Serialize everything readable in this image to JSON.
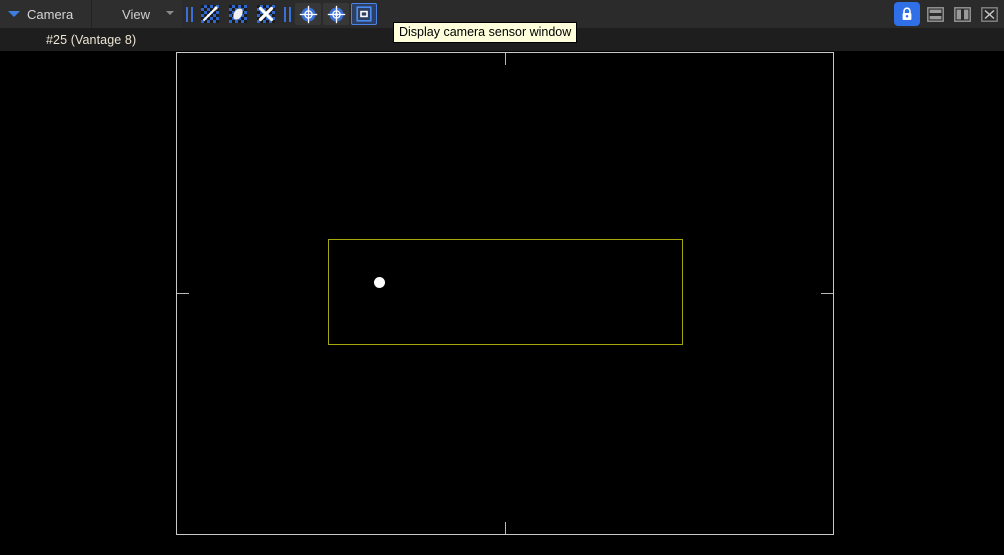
{
  "header": {
    "camera_menu": {
      "label": "Camera",
      "icon": "chevron-down-icon"
    },
    "view_menu": {
      "label": "View",
      "icon": "chevron-down-small-icon"
    },
    "toolbar_buttons": [
      {
        "name": "separator-1",
        "icon": "double-bar-icon",
        "type": "separator"
      },
      {
        "name": "crosshair-line-tool",
        "icon": "diagonal-line-checker-icon",
        "type": "button",
        "active": false
      },
      {
        "name": "ellipse-tool",
        "icon": "ellipse-checker-icon",
        "type": "button",
        "active": false
      },
      {
        "name": "clear-tool",
        "icon": "x-mark-checker-icon",
        "type": "button",
        "active": false
      },
      {
        "name": "separator-2",
        "icon": "double-bar-icon",
        "type": "separator"
      },
      {
        "name": "target-center-tool",
        "icon": "crosshair-target-icon",
        "type": "button",
        "active": false
      },
      {
        "name": "target-point-tool",
        "icon": "crosshair-target-icon",
        "type": "button",
        "active": false
      },
      {
        "name": "sensor-window-toggle",
        "icon": "nested-square-icon",
        "type": "button",
        "active": true
      }
    ],
    "window_controls": [
      {
        "name": "lock-button",
        "icon": "lock-icon",
        "active": true
      },
      {
        "name": "split-horizontal-button",
        "icon": "split-horizontal-icon",
        "active": false
      },
      {
        "name": "split-vertical-button",
        "icon": "split-vertical-icon",
        "active": false
      },
      {
        "name": "close-button",
        "icon": "close-x-icon",
        "active": false
      }
    ]
  },
  "sub_bar": {
    "vantage_label": "#25 (Vantage 8)"
  },
  "tooltip": {
    "text": "Display camera sensor window",
    "background": "#ffffdc",
    "border": "#000000"
  },
  "viewport": {
    "background": "#000000",
    "sensor_frame": {
      "name": "camera-sensor-frame",
      "border_color": "#c9c9c9",
      "ticks": [
        "top-center",
        "bottom-center",
        "left-center",
        "right-center"
      ]
    },
    "fov_rect": {
      "name": "field-of-view-rectangle",
      "border_color": "#a6a60e"
    },
    "star_point": {
      "name": "target-star-marker",
      "color": "#ffffff"
    }
  },
  "colors": {
    "accent_blue": "#2f6fe8",
    "header_bg": "#2b2b2b",
    "sub_bar_bg": "#1e1e1e",
    "icon_blue": "#2f66cc",
    "fov_yellow": "#a6a60e"
  }
}
